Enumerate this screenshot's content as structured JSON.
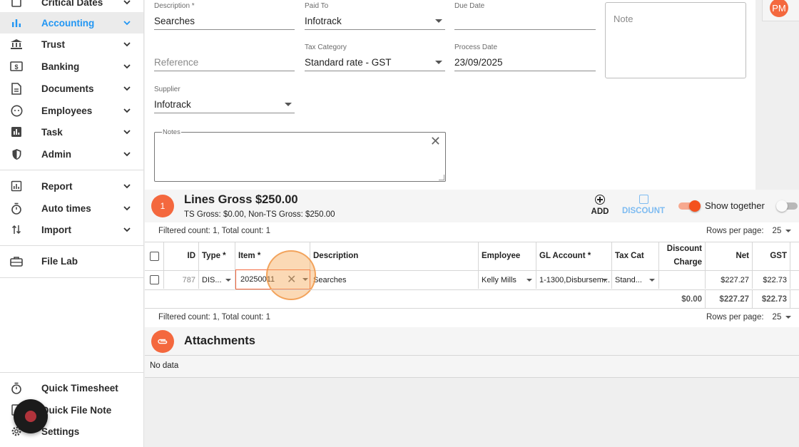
{
  "sidebar": {
    "items": [
      {
        "label": "Critical Dates",
        "icon": "checkbox-icon"
      },
      {
        "label": "Accounting",
        "icon": "bar-chart-icon",
        "active": true
      },
      {
        "label": "Trust",
        "icon": "bank-icon"
      },
      {
        "label": "Banking",
        "icon": "dollar-note-icon"
      },
      {
        "label": "Documents",
        "icon": "document-icon"
      },
      {
        "label": "Employees",
        "icon": "face-icon"
      },
      {
        "label": "Task",
        "icon": "chart-square-icon"
      },
      {
        "label": "Admin",
        "icon": "shield-icon"
      },
      {
        "label": "Report",
        "icon": "report-icon"
      },
      {
        "label": "Auto times",
        "icon": "stopwatch-icon"
      },
      {
        "label": "Import",
        "icon": "import-arrows-icon"
      },
      {
        "label": "File Lab",
        "icon": "briefcase-icon"
      }
    ],
    "footer": [
      {
        "label": "Quick Timesheet",
        "icon": "stopwatch-icon"
      },
      {
        "label": "Quick File Note",
        "icon": "note-icon"
      },
      {
        "label": "Settings",
        "icon": "gear-icon"
      }
    ]
  },
  "user": {
    "initials": "PM"
  },
  "form": {
    "description": {
      "label": "Description *",
      "value": "Searches"
    },
    "paid_to": {
      "label": "Paid To",
      "value": "Infotrack"
    },
    "due_date": {
      "label": "Due Date",
      "value": ""
    },
    "note": {
      "placeholder": "Note"
    },
    "reference": {
      "placeholder": "Reference"
    },
    "tax_category": {
      "label": "Tax Category",
      "value": "Standard rate - GST"
    },
    "process_date": {
      "label": "Process Date",
      "value": "23/09/2025"
    },
    "supplier": {
      "label": "Supplier",
      "value": "Infotrack"
    },
    "notes": {
      "label": "Notes",
      "value": ""
    }
  },
  "lines": {
    "badge": "1",
    "title": "Lines Gross $250.00",
    "subtitle": "TS Gross: $0.00, Non-TS Gross: $250.00",
    "add_label": "ADD",
    "discount_label": "DISCOUNT",
    "show_together_label": "Show together",
    "filtered_count": "Filtered count: 1, Total count: 1",
    "rows_per_page_label": "Rows per page:",
    "rows_per_page": "25",
    "columns": [
      "ID",
      "Type *",
      "Item *",
      "Description",
      "Employee",
      "GL Account *",
      "Tax Cat",
      "Discount Charge",
      "Net",
      "GST"
    ],
    "rows": [
      {
        "id": "787",
        "type": "DIS...",
        "item": "20250011",
        "description": "Searches",
        "employee": "Kelly Mills",
        "gl_account": "1-1300,Disbursem...",
        "tax_cat": "Stand...",
        "discount": "",
        "net": "$227.27",
        "gst": "$22.73"
      }
    ],
    "totals": {
      "discount": "$0.00",
      "net": "$227.27",
      "gst": "$22.73"
    }
  },
  "attachments": {
    "title": "Attachments",
    "empty_text": "No data"
  },
  "colors": {
    "accent": "#f4683e",
    "active_nav": "#2196f3"
  }
}
